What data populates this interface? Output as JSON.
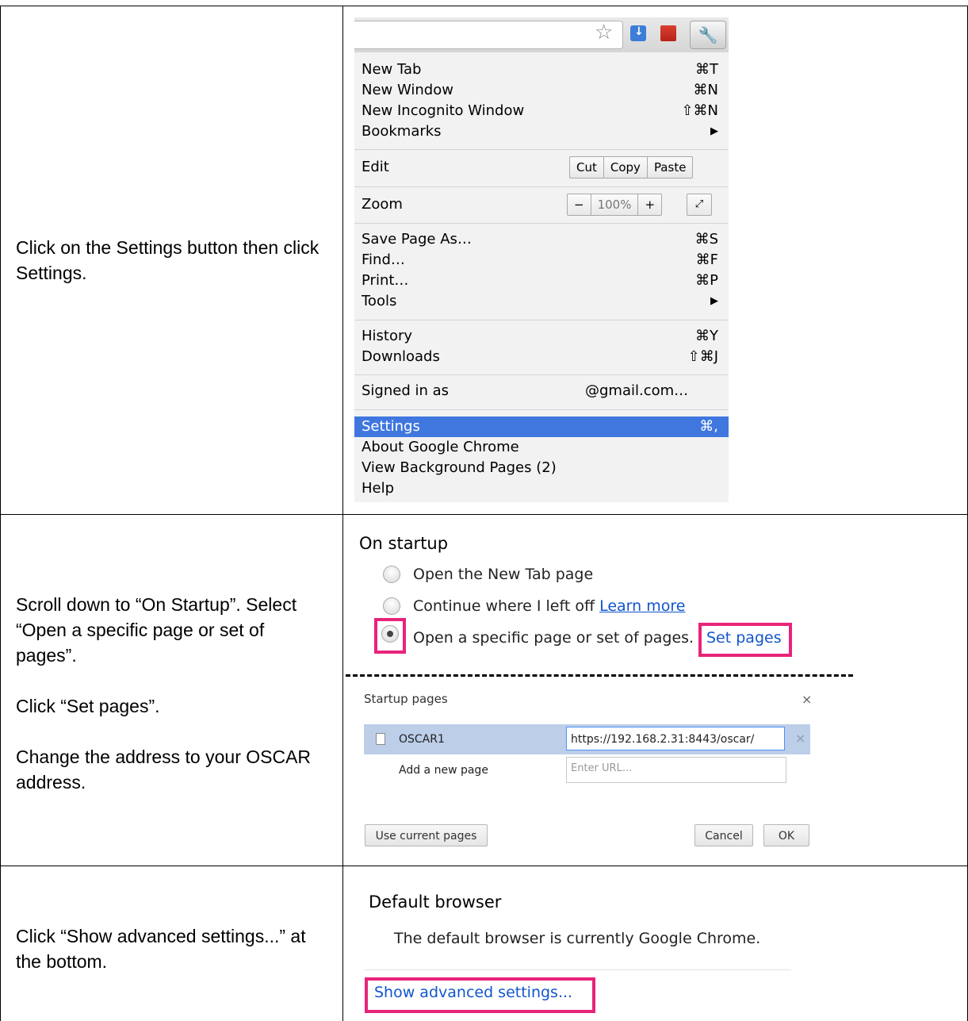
{
  "rows": [
    {
      "instructions": [
        "Click on the Settings button then click Settings."
      ]
    },
    {
      "instructions": [
        "Scroll down to “On Startup”. Select “Open a specific page or set of pages”.",
        "Click “Set pages”.",
        "Change the address to your OSCAR address."
      ]
    },
    {
      "instructions": [
        "Click “Show advanced settings...” at the bottom."
      ]
    }
  ],
  "chrome_menu": {
    "toolbar_icons": [
      "star-icon",
      "download-icon",
      "pdf-icon",
      "wrench-icon"
    ],
    "items": {
      "new_tab": {
        "label": "New Tab",
        "shortcut": "⌘T"
      },
      "new_window": {
        "label": "New Window",
        "shortcut": "⌘N"
      },
      "new_incognito": {
        "label": "New Incognito Window",
        "shortcut": "⇧⌘N"
      },
      "bookmarks": {
        "label": "Bookmarks",
        "arrow": "▶"
      },
      "edit": {
        "label": "Edit",
        "cut": "Cut",
        "copy": "Copy",
        "paste": "Paste"
      },
      "zoom": {
        "label": "Zoom",
        "minus": "−",
        "level": "100%",
        "plus": "+"
      },
      "save_page": {
        "label": "Save Page As…",
        "shortcut": "⌘S"
      },
      "find": {
        "label": "Find…",
        "shortcut": "⌘F"
      },
      "print": {
        "label": "Print…",
        "shortcut": "⌘P"
      },
      "tools": {
        "label": "Tools",
        "arrow": "▶"
      },
      "history": {
        "label": "History",
        "shortcut": "⌘Y"
      },
      "downloads": {
        "label": "Downloads",
        "shortcut": "⇧⌘J"
      },
      "signed_in": {
        "label": "Signed in as",
        "value": "@gmail.com…"
      },
      "settings": {
        "label": "Settings",
        "shortcut": "⌘,"
      },
      "about": {
        "label": "About Google Chrome"
      },
      "background_pages": {
        "label": "View Background Pages (2)"
      },
      "help": {
        "label": "Help"
      }
    }
  },
  "on_startup": {
    "heading": "On startup",
    "options": {
      "new_tab": "Open the New Tab page",
      "continue": "Continue where I left off",
      "learn_more": "Learn more",
      "specific": "Open a specific page or set of pages.",
      "set_pages": "Set pages"
    },
    "selected": "specific"
  },
  "startup_dialog": {
    "title": "Startup pages",
    "close": "×",
    "page_name": "OSCAR1",
    "page_url": "https://192.168.2.31:8443/oscar/",
    "add_label": "Add a new page",
    "url_placeholder": "Enter URL...",
    "remove": "×",
    "use_current": "Use current pages",
    "cancel": "Cancel",
    "ok": "OK"
  },
  "default_browser": {
    "heading": "Default browser",
    "text": "The default browser is currently Google Chrome.",
    "advanced_link": "Show advanced settings..."
  },
  "colors": {
    "highlight": "#e8237a",
    "menu_selection": "#3f77df",
    "link": "#1155cc",
    "dialog_row": "#bccee8"
  }
}
